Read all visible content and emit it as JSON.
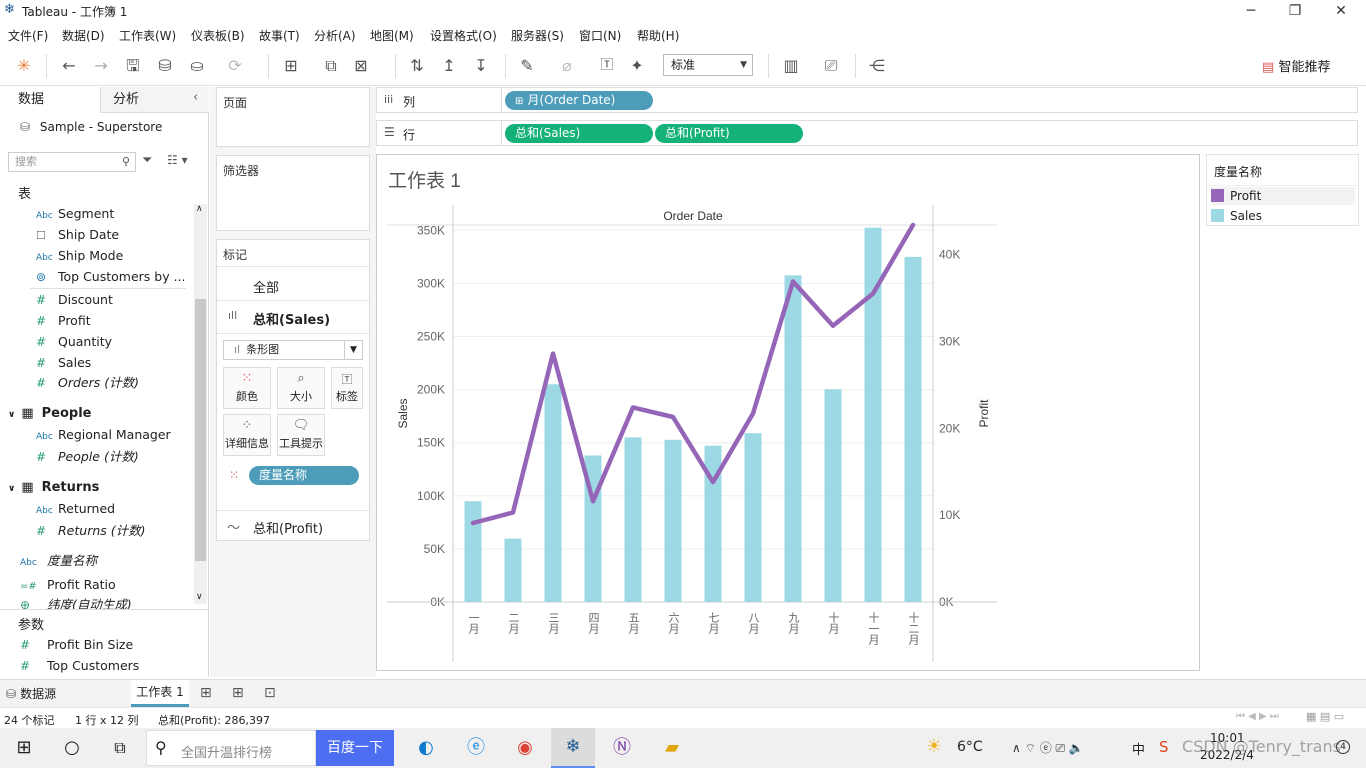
{
  "window": {
    "title": "Tableau - 工作簿 1",
    "minimize": "─",
    "restore": "❐",
    "close": "✕"
  },
  "menu": [
    "文件(F)",
    "数据(D)",
    "工作表(W)",
    "仪表板(B)",
    "故事(T)",
    "分析(A)",
    "地图(M)",
    "设置格式(O)",
    "服务器(S)",
    "窗口(N)",
    "帮助(H)"
  ],
  "toolbar": {
    "mark_select": "标准",
    "smart_label": "智能推荐"
  },
  "left_pane": {
    "tab_data": "数据",
    "tab_analysis": "分析",
    "datasource": "Sample - Superstore",
    "search_placeholder": "搜索",
    "tables_label": "表",
    "fields_orders": [
      {
        "type": "Abc",
        "name": "Segment"
      },
      {
        "type": "date",
        "name": "Ship Date"
      },
      {
        "type": "Abc",
        "name": "Ship Mode"
      },
      {
        "type": "set",
        "name": "Top Customers by ..."
      },
      {
        "type": "#",
        "name": "Discount"
      },
      {
        "type": "#",
        "name": "Profit"
      },
      {
        "type": "#",
        "name": "Quantity"
      },
      {
        "type": "#",
        "name": "Sales"
      },
      {
        "type": "#",
        "name": "Orders (计数)"
      }
    ],
    "people_label": "People",
    "people_fields": [
      {
        "type": "Abc",
        "name": "Regional Manager"
      },
      {
        "type": "#",
        "name": "People (计数)"
      }
    ],
    "returns_label": "Returns",
    "returns_fields": [
      {
        "type": "Abc",
        "name": "Returned"
      },
      {
        "type": "#",
        "name": "Returns (计数)"
      }
    ],
    "extra_fields": [
      {
        "type": "Abc",
        "name": "度量名称"
      },
      {
        "type": "=#",
        "name": "Profit Ratio"
      },
      {
        "type": "geo",
        "name": "纬度(自动生成)"
      }
    ],
    "params_label": "参数",
    "params": [
      {
        "type": "#",
        "name": "Profit Bin Size"
      },
      {
        "type": "#",
        "name": "Top Customers"
      }
    ]
  },
  "shelves": {
    "pages": "页面",
    "filters": "筛选器",
    "columns_label": "列",
    "rows_label": "行",
    "column_pill": "月(Order Date)",
    "row_pills": [
      "总和(Sales)",
      "总和(Profit)"
    ]
  },
  "marks": {
    "title": "标记",
    "all": "全部",
    "sales": "总和(Sales)",
    "mark_type": "条形图",
    "buttons": [
      "颜色",
      "大小",
      "标签",
      "详细信息",
      "工具提示"
    ],
    "color_pill": "度量名称",
    "profit": "总和(Profit)"
  },
  "chart_data": {
    "type": "bar+line",
    "title": "工作表 1",
    "top_header": "Order Date",
    "categories": [
      "一月",
      "二月",
      "三月",
      "四月",
      "五月",
      "六月",
      "七月",
      "八月",
      "九月",
      "十月",
      "十一月",
      "十二月"
    ],
    "series": [
      {
        "name": "Sales",
        "type": "bar",
        "axis": "left",
        "color": "#9dd9e4",
        "values": [
          94900,
          59700,
          205000,
          138000,
          155000,
          152700,
          147200,
          159000,
          307600,
          200300,
          352500,
          325000
        ]
      },
      {
        "name": "Profit",
        "type": "line",
        "axis": "right",
        "color": "#9566b8",
        "values": [
          9100,
          10300,
          28600,
          11600,
          22400,
          21300,
          13800,
          21700,
          36900,
          31800,
          35500,
          43400
        ]
      }
    ],
    "ylabel": "Sales",
    "y2label": "Profit",
    "ylim": [
      0,
      355000
    ],
    "y2lim": [
      0,
      43400
    ],
    "yticks": [
      "0K",
      "50K",
      "100K",
      "150K",
      "200K",
      "250K",
      "300K",
      "350K"
    ],
    "y2ticks": [
      "0K",
      "10K",
      "20K",
      "30K",
      "40K"
    ],
    "y2tick_values": [
      0,
      10000,
      20000,
      30000,
      40000
    ]
  },
  "legend": {
    "title": "度量名称",
    "items": [
      {
        "name": "Profit",
        "color": "#9566b8"
      },
      {
        "name": "Sales",
        "color": "#9dd9e4"
      }
    ]
  },
  "sheet_tabs": {
    "datasource": "数据源",
    "sheet": "工作表 1"
  },
  "status": {
    "marks": "24 个标记",
    "dims": "1 行 x 12 列",
    "sum": "总和(Profit): 286,397"
  },
  "taskbar": {
    "search_placeholder": "全国升温排行榜",
    "search_button": "百度一下",
    "weather": "6°C",
    "ime": "中",
    "time": "10:01",
    "date": "2022/2/4",
    "watermark": "CSDN @Tenry_trans"
  }
}
